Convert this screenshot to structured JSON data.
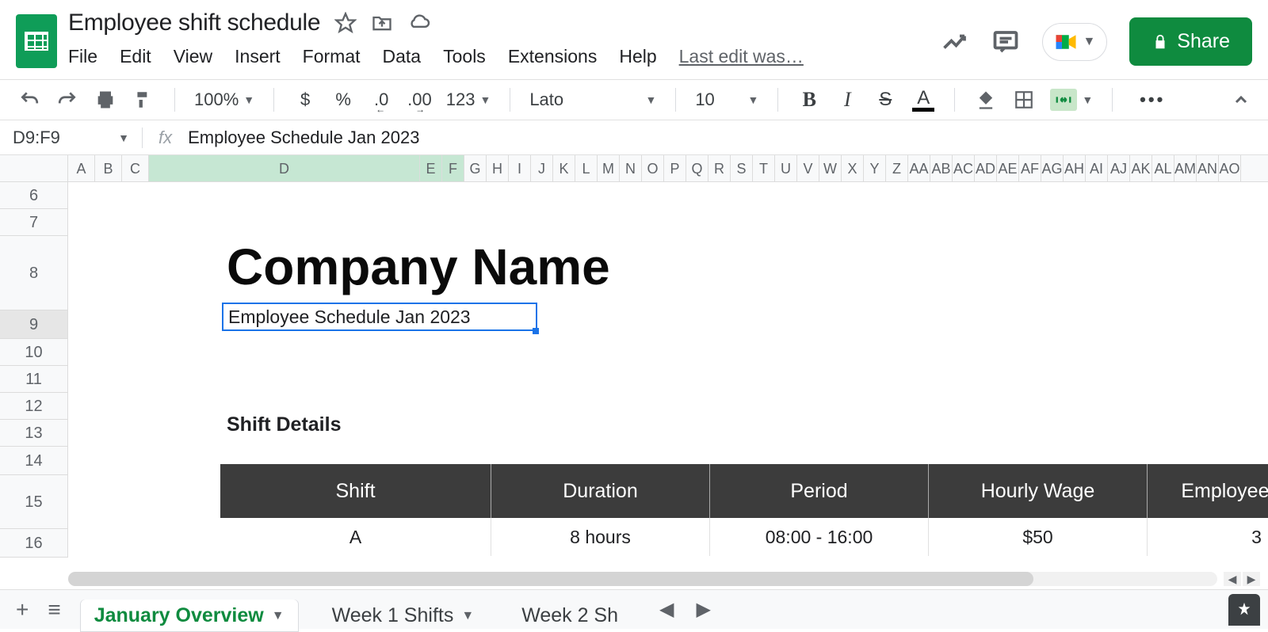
{
  "doc": {
    "title": "Employee shift schedule"
  },
  "menu": {
    "file": "File",
    "edit": "Edit",
    "view": "View",
    "insert": "Insert",
    "format": "Format",
    "data": "Data",
    "tools": "Tools",
    "extensions": "Extensions",
    "help": "Help",
    "last_edit": "Last edit was…"
  },
  "share": {
    "label": "Share"
  },
  "toolbar": {
    "zoom": "100%",
    "currency": "$",
    "percent": "%",
    "dec_dec": ".0",
    "dec_inc": ".00",
    "num_format": "123",
    "font": "Lato",
    "size": "10"
  },
  "namebox": {
    "ref": "D9:F9"
  },
  "formula": {
    "text": "Employee Schedule Jan 2023"
  },
  "cols": [
    "A",
    "B",
    "C",
    "D",
    "E",
    "F",
    "G",
    "H",
    "I",
    "J",
    "K",
    "L",
    "M",
    "N",
    "O",
    "P",
    "Q",
    "R",
    "S",
    "T",
    "U",
    "V",
    "W",
    "X",
    "Y",
    "Z",
    "AA",
    "AB",
    "AC",
    "AD",
    "AE",
    "AF",
    "AG",
    "AH",
    "AI",
    "AJ",
    "AK",
    "AL",
    "AM",
    "AN",
    "AO"
  ],
  "col_widths": {
    "A": 34,
    "B": 34,
    "C": 34,
    "D": 342,
    "default": 28
  },
  "selected_cols": [
    "D",
    "E",
    "F"
  ],
  "rows": [
    6,
    7,
    8,
    9,
    10,
    11,
    12,
    13,
    14,
    15,
    16
  ],
  "row_heights": {
    "6": 34,
    "7": 34,
    "8": 94,
    "9": 36,
    "10": 34,
    "11": 34,
    "12": 34,
    "13": 34,
    "14": 36,
    "15": 68,
    "16": 36
  },
  "selected_row": 9,
  "sheet": {
    "company": "Company Name",
    "subtitle": "Employee Schedule Jan 2023",
    "section": "Shift Details",
    "table": {
      "headers": [
        "Shift",
        "Duration",
        "Period",
        "Hourly Wage",
        "Employees per S"
      ],
      "widths": [
        342,
        276,
        276,
        276,
        276
      ],
      "rows": [
        [
          "A",
          "8 hours",
          "08:00 - 16:00",
          "$50",
          "3"
        ]
      ]
    }
  },
  "tabs": {
    "active": "January Overview",
    "others": [
      "Week 1 Shifts",
      "Week 2 Sh"
    ]
  }
}
